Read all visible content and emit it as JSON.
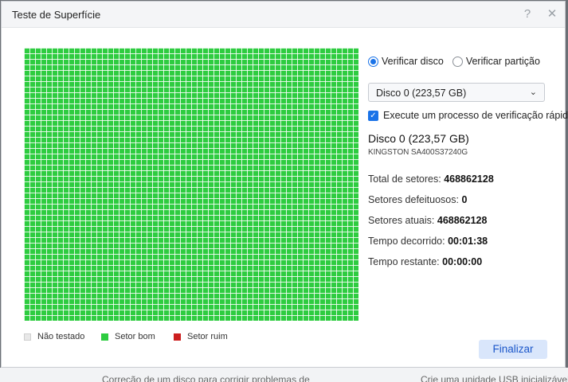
{
  "dialog": {
    "title": "Teste de Superfície",
    "help_icon": "question-icon",
    "close_icon": "close-icon"
  },
  "scan": {
    "progress": 1.0,
    "colors": {
      "untested": "#e8e8e8",
      "good": "#2ecc40",
      "bad": "#cc1f1f"
    }
  },
  "legend": {
    "untested": "Não testado",
    "good": "Setor bom",
    "bad": "Setor ruim"
  },
  "options": {
    "mode_disk": "Verificar disco",
    "mode_partition": "Verificar partição",
    "selected_mode": "disk",
    "disk_select": "Disco 0 (223,57 GB)",
    "quick_check_label": "Execute um processo de verificação rápida",
    "quick_check": true
  },
  "disk": {
    "name": "Disco 0 (223,57 GB)",
    "model": "KINGSTON SA400S37240G"
  },
  "stats": {
    "total_label": "Total de setores:",
    "total_value": "468862128",
    "bad_label": "Setores defeituosos:",
    "bad_value": "0",
    "current_label": "Setores atuais:",
    "current_value": "468862128",
    "elapsed_label": "Tempo decorrido:",
    "elapsed_value": "00:01:38",
    "remaining_label": "Tempo restante:",
    "remaining_value": "00:00:00"
  },
  "buttons": {
    "finish": "Finalizar"
  },
  "background": {
    "text_left": "Correção de um disco para corrigir problemas de",
    "text_right": "Crie uma unidade USB inicializável"
  }
}
